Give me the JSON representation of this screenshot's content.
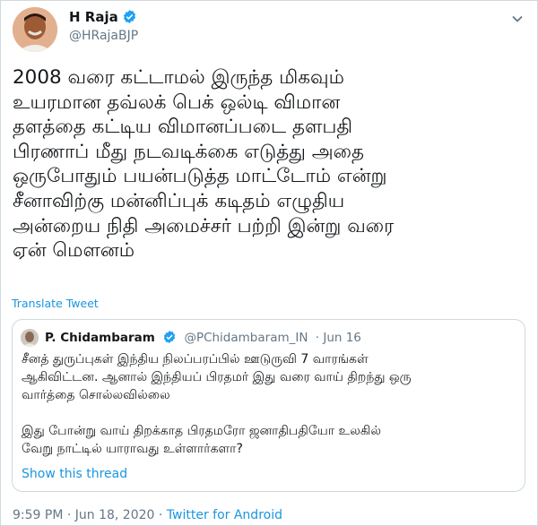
{
  "author": {
    "name": "H Raja",
    "handle": "@HRajaBJP"
  },
  "tweet": {
    "text": "2008 வரை கட்டாமல் இருந்த மிகவும்\nஉயரமான தவ்லக் பெக் ஒல்டி விமான\nதளத்தை கட்டிய விமானப்படை தளபதி\nபிரணாப் மீது நடவடிக்கை எடுத்து அதை\nஒருபோதும் பயன்படுத்த மாட்டோம் என்று\nசீனாவிற்கு மன்னிப்புக் கடிதம் எழுதிய\nஅன்றைய நிதி அமைச்சர் பற்றி இன்று வரை\nஏன் மௌனம்",
    "translate_label": "Translate Tweet"
  },
  "quoted": {
    "name": "P. Chidambaram",
    "handle": "@PChidambaram_IN",
    "date": "· Jun 16",
    "text": "சீனத் துருப்புகள் இந்திய நிலப்பரப்பில் ஊடுருவி 7 வாரங்கள்\nஆகிவிட்டன. ஆனால் இந்தியப் பிரதமர் இது வரை வாய் திறந்து ஒரு\nவார்த்தை சொல்லவில்லை\n\nஇது போன்று வாய் திறக்காத பிரதமரோ ஜனாதிபதியோ உலகில்\nவேறு நாட்டில் யாராவது உள்ளார்களா?",
    "show_thread": "Show this thread"
  },
  "footer": {
    "timestamp": "9:59 PM · Jun 18, 2020 · ",
    "source": "Twitter for Android"
  },
  "colors": {
    "verified": "#1da1f2",
    "link": "#1b95e0",
    "muted": "#657786"
  }
}
